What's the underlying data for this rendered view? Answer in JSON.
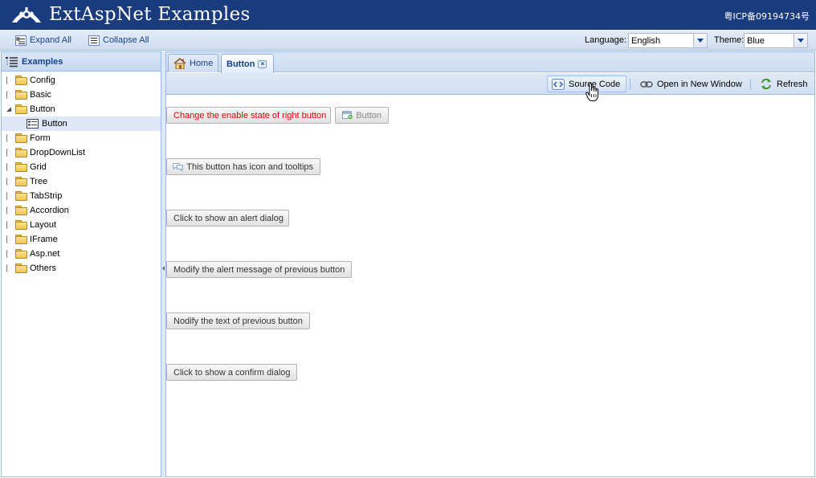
{
  "header": {
    "title": "ExtAspNet Examples",
    "icp": "粤ICP备09194734号"
  },
  "topbar": {
    "expand_all": "Expand All",
    "collapse_all": "Collapse All",
    "language_label": "Language:",
    "language_value": "English",
    "theme_label": "Theme:",
    "theme_value": "Blue"
  },
  "sidebar": {
    "title": "Examples",
    "items": [
      {
        "label": "Config",
        "state": "collapsed"
      },
      {
        "label": "Basic",
        "state": "collapsed"
      },
      {
        "label": "Button",
        "state": "expanded"
      },
      {
        "label": "Button",
        "state": "leaf-selected"
      },
      {
        "label": "Form",
        "state": "collapsed"
      },
      {
        "label": "DropDownList",
        "state": "collapsed"
      },
      {
        "label": "Grid",
        "state": "collapsed"
      },
      {
        "label": "Tree",
        "state": "collapsed"
      },
      {
        "label": "TabStrip",
        "state": "collapsed"
      },
      {
        "label": "Accordion",
        "state": "collapsed"
      },
      {
        "label": "Layout",
        "state": "collapsed"
      },
      {
        "label": "IFrame",
        "state": "collapsed"
      },
      {
        "label": "Asp.net",
        "state": "collapsed"
      },
      {
        "label": "Others",
        "state": "collapsed"
      }
    ]
  },
  "tabs": [
    {
      "label": "Home",
      "icon": "home-icon",
      "active": false
    },
    {
      "label": "Button",
      "active": true,
      "closable": true
    }
  ],
  "subbar": {
    "source_code": "Source Code",
    "open_new_window": "Open in New Window",
    "refresh": "Refresh"
  },
  "main": {
    "btn_change_enable": "Change the enable state of right button",
    "btn_disabled": "Button",
    "btn_icon_tooltips": "This button has icon and tooltips",
    "btn_show_alert": "Click to show an alert dialog",
    "btn_modify_alert": "Modify the alert message of previous button",
    "btn_modify_text": "Nodify the text of previous button",
    "btn_show_confirm": "Click to show a confirm dialog"
  },
  "colors": {
    "header_bg": "#1a3b7d",
    "accent": "#15428b",
    "red_text": "#e00000"
  }
}
